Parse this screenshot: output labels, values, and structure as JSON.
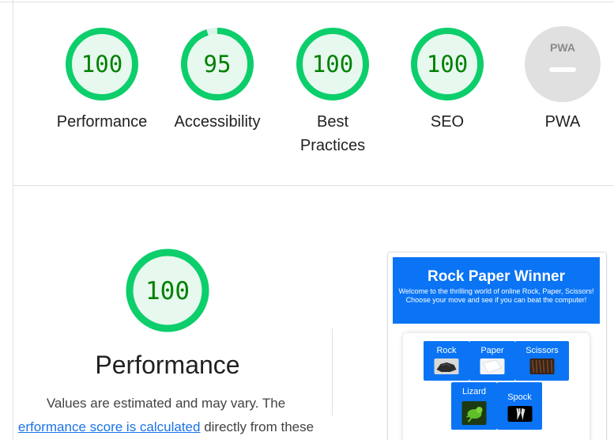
{
  "summary_gauges": [
    {
      "score": "100",
      "score_value": 100,
      "label": "Performance",
      "color": "#0cce6b",
      "fill": "#e7f8ef",
      "text_color": "#008000"
    },
    {
      "score": "95",
      "score_value": 95,
      "label": "Accessibility",
      "color": "#0cce6b",
      "fill": "#e7f8ef",
      "text_color": "#008000"
    },
    {
      "score": "100",
      "score_value": 100,
      "label": "Best Practices",
      "label_lines": [
        "Best",
        "Practices"
      ],
      "color": "#0cce6b",
      "fill": "#e7f8ef",
      "text_color": "#008000"
    },
    {
      "score": "100",
      "score_value": 100,
      "label": "SEO",
      "color": "#0cce6b",
      "fill": "#e7f8ef",
      "text_color": "#008000"
    },
    {
      "badge_text": "PWA",
      "label": "PWA",
      "color": "#e0e0e0",
      "fill": "#e0e0e0"
    }
  ],
  "performance_section": {
    "score": "100",
    "score_value": 100,
    "title": "Performance",
    "description_line1": "Values are estimated and may vary. The",
    "link_text": "erformance score is calculated",
    "description_line2_suffix": " directly from these",
    "color": "#0cce6b",
    "fill": "#e7f8ef",
    "text_color": "#008000",
    "link_color": "#1a73e8"
  },
  "preview": {
    "title": "Rock Paper Winner",
    "subtitle": "Welcome to the thrilling world of online Rock, Paper, Scissors! Choose your move and see if you can beat the computer!",
    "accent": "#0a74f5",
    "choices": [
      {
        "label": "Rock",
        "icon": "rock-thumbnail"
      },
      {
        "label": "Paper",
        "icon": "paper-thumbnail"
      },
      {
        "label": "Scissors",
        "icon": "scissors-thumbnail"
      },
      {
        "label": "Lizard",
        "icon": "lizard-thumbnail"
      },
      {
        "label": "Spock",
        "icon": "spock-hand-thumbnail"
      }
    ]
  }
}
